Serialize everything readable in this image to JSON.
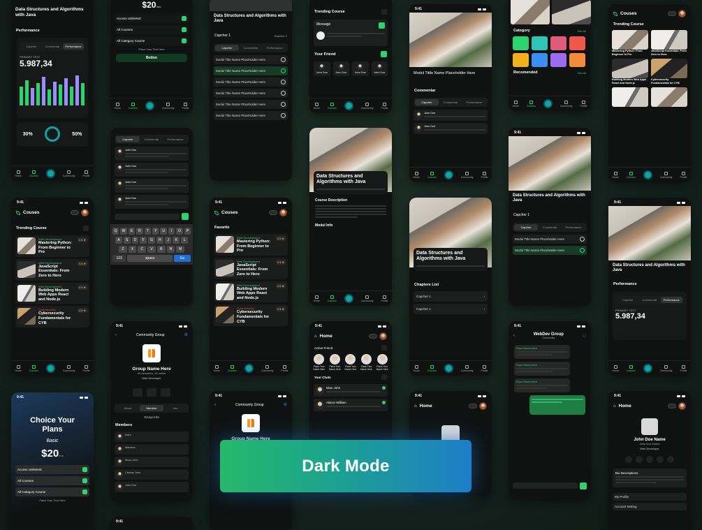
{
  "banner": {
    "label": "Dark Mode"
  },
  "status_time": "9:41",
  "accent_green": "#2dd36f",
  "courses_screen": {
    "title": "Couses",
    "trending": "Trending Course",
    "favorite": "Favorite",
    "items": [
      {
        "category": "Web Development",
        "title": "Mastering Python: From Beginner to Pro",
        "rating": "4.5 ★"
      },
      {
        "category": "Web Development",
        "title": "JavaScript Essentials: From Zero to Hero",
        "rating": "4.5 ★"
      },
      {
        "category": "Web Development",
        "title": "Building Modern Web Apps React and Node.js",
        "rating": "4.5 ★"
      },
      {
        "category": "Cybersecurity",
        "title": "Cybersecurity Fundamentals for CYB",
        "rating": "4.5 ★"
      }
    ]
  },
  "tabbar": [
    "Home",
    "Courses",
    "Community",
    "Profile"
  ],
  "performance": {
    "title": "Performance",
    "tabs": [
      "Capcher",
      "Commentar",
      "Performance"
    ],
    "primary_label": "PRIMARY TEXT",
    "primary_value": "5.987,34",
    "stat_left": "30%",
    "stat_right": "50%"
  },
  "course_detail": {
    "title": "Data Structures and Algorithms with Java",
    "chapter": "Capcher 1",
    "modules": [
      "Modul Title Name Placeholder Here",
      "Modul Title Name Placeholder Here",
      "Modul Title Name Placeholder Here",
      "Modul Title Name Placeholder Here",
      "Modul Title Name Placeholder Here",
      "Modul Title Name Placeholder Here"
    ],
    "description_title": "Course Description",
    "modul_info": "Modul Info",
    "chapters_list": "Chapters List",
    "chapter_items": [
      "Capcher 1",
      "Capcher 1"
    ]
  },
  "video": {
    "title": "Modul Tittle Name Placeholder Here",
    "commentar": "Commentar"
  },
  "plans": {
    "title": "Choice Your Plans",
    "tier": "Basic",
    "price": "$20",
    "per": "/mo",
    "options": [
      "Access Unlimited",
      "All Courses",
      "All Category Course"
    ],
    "place_text": "Place Your Text Here",
    "button": "Button"
  },
  "community": {
    "header": "Community Group",
    "group_name": "Group Name Here",
    "members_info": "49 members, 25 online",
    "role": "Web Developer",
    "tabs": [
      "About",
      "Member",
      "Info"
    ],
    "group_info": "Group Info",
    "members": "Members",
    "names": [
      "Indra",
      "Maulana",
      "Moza John",
      "Carlose John",
      "John Doe"
    ]
  },
  "trending_course": {
    "title": "Trending Course",
    "message": "Message",
    "your_friend": "Your Friend",
    "friend_name": "John Doe"
  },
  "home_chat": {
    "title": "Home",
    "active_friend": "Active Friend",
    "your_chats": "Your Chats",
    "chats": [
      "Dian John",
      "Alaron William"
    ],
    "friend_label": "Place Your Name Here"
  },
  "webdev_group": {
    "title": "WebDev Group",
    "subtitle": "Community",
    "sender": "Place Name Here"
  },
  "explore": {
    "category": "Category",
    "recommended": "Recomended",
    "see_all": "See All"
  },
  "profile": {
    "title": "Home",
    "name": "John Doe Name",
    "username": "John Doe Name",
    "role": "Web Developer",
    "bio_title": "Bio Descriptions",
    "my_profile": "My Profile",
    "account": "Account Setting"
  },
  "keyboard": {
    "row1": [
      "Q",
      "W",
      "E",
      "R",
      "T",
      "Y",
      "U",
      "I",
      "O",
      "P"
    ],
    "row2": [
      "A",
      "S",
      "D",
      "F",
      "G",
      "H",
      "J",
      "K",
      "L"
    ],
    "row3": [
      "Z",
      "X",
      "C",
      "V",
      "B",
      "N",
      "M"
    ],
    "num": "123",
    "space": "space",
    "go": "Go"
  }
}
